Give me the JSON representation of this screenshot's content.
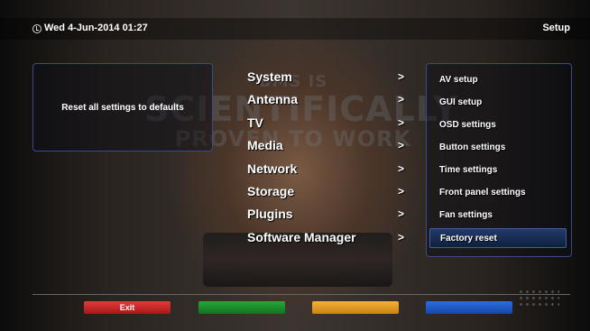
{
  "header": {
    "datetime": "Wed  4-Jun-2014 01:27",
    "title": "Setup",
    "clock_icon": "clock-icon"
  },
  "description": "Reset all settings to defaults",
  "menu": {
    "items": [
      {
        "label": "System",
        "arrow": ">"
      },
      {
        "label": "Antenna",
        "arrow": ">"
      },
      {
        "label": "TV",
        "arrow": ">"
      },
      {
        "label": "Media",
        "arrow": ">"
      },
      {
        "label": "Network",
        "arrow": ">"
      },
      {
        "label": "Storage",
        "arrow": ">"
      },
      {
        "label": "Plugins",
        "arrow": ">"
      },
      {
        "label": "Software Manager",
        "arrow": ">"
      }
    ]
  },
  "submenu": {
    "items": [
      "AV setup",
      "GUI setup",
      "OSD settings",
      "Button settings",
      "Time settings",
      "Front panel settings",
      "Fan settings",
      "Factory reset"
    ],
    "selected_index": 7
  },
  "background_text": {
    "line1": "BMS IS",
    "line2": "SCIENTIFICALLY",
    "line3": "PROVEN TO WORK"
  },
  "footer": {
    "red_label": "Exit",
    "green_label": "",
    "yellow_label": "",
    "blue_label": ""
  },
  "colors": {
    "red": "#c42020",
    "green": "#1e8f2e",
    "yellow": "#e89a1a",
    "blue": "#1f5bc8",
    "border": "#3a4a8a"
  }
}
